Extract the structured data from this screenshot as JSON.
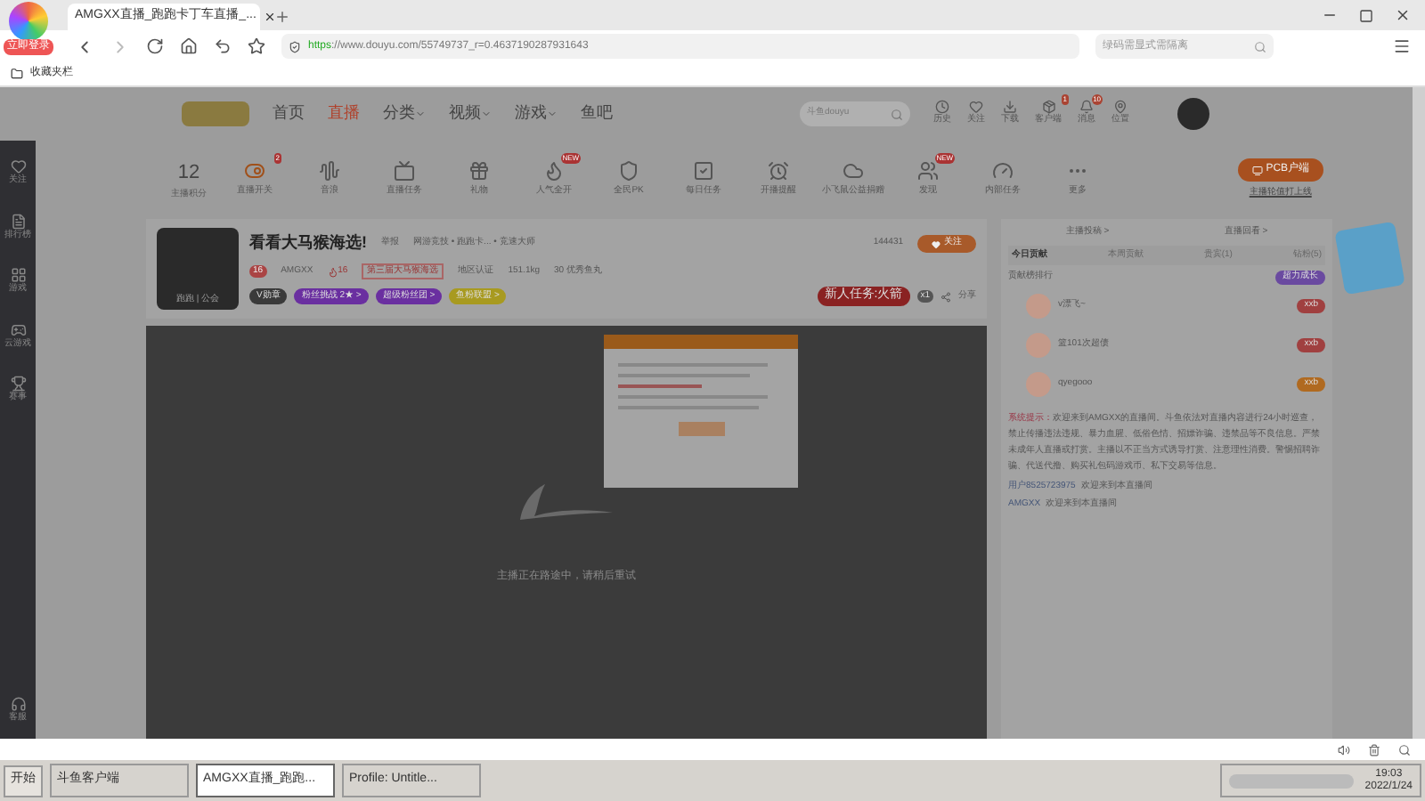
{
  "browser": {
    "tab_title": "AMGXX直播_跑跑卡丁车直播_...",
    "login_badge": "立即登录",
    "url_scheme": "https",
    "url_rest": "://www.douyu.com/55749737_r=0.4637190287931643",
    "search_placeholder": "绿码需显式需隔离",
    "bookmark": "收藏夹栏"
  },
  "sidebar": [
    {
      "label": "关注"
    },
    {
      "label": "排行榜"
    },
    {
      "label": "游戏"
    },
    {
      "label": "云游戏"
    },
    {
      "label": "赛事"
    },
    {
      "label": "客服"
    }
  ],
  "nav": {
    "items": [
      {
        "label": "首页",
        "selected": false,
        "dropdown": false
      },
      {
        "label": "直播",
        "selected": true,
        "dropdown": false
      },
      {
        "label": "分类",
        "selected": false,
        "dropdown": true
      },
      {
        "label": "视频",
        "selected": false,
        "dropdown": true
      },
      {
        "label": "游戏",
        "selected": false,
        "dropdown": true
      },
      {
        "label": "鱼吧",
        "selected": false,
        "dropdown": false
      }
    ],
    "search_placeholder": "斗鱼douyu",
    "user_items": [
      {
        "label": "历史"
      },
      {
        "label": "关注"
      },
      {
        "label": "下载"
      },
      {
        "label": "客户端",
        "badge": "1"
      },
      {
        "label": "消息",
        "badge": "10"
      },
      {
        "label": "位置"
      }
    ]
  },
  "toolbar": {
    "score": "12",
    "score_label": "主播积分",
    "tools": [
      {
        "label": "直播开关",
        "badge": "2"
      },
      {
        "label": "音浪"
      },
      {
        "label": "直播任务"
      },
      {
        "label": "礼物"
      },
      {
        "label": "人气全开",
        "badge": "NEW"
      },
      {
        "label": "全民PK"
      },
      {
        "label": "每日任务"
      },
      {
        "label": "开播提醒"
      },
      {
        "label": "小飞鼠公益捐赠"
      },
      {
        "label": "发现",
        "badge": "NEW"
      },
      {
        "label": "内部任务"
      },
      {
        "label": "更多"
      }
    ],
    "pcb_button": "PCB户端",
    "pcb_link": "主播轮值打上线"
  },
  "streamer": {
    "title": "看看大马猴海选!",
    "report": "举报",
    "category": "网游竞技 • 跑跑卡... • 竞速大师",
    "level": "16",
    "name": "AMGXX",
    "hot": "16",
    "rank": "第三届大马猴海选",
    "location": "地区认证",
    "weight": "151.1kg",
    "count": "30 优秀鱼丸",
    "avatar_text": "跑跑 | 公会",
    "tags": [
      {
        "label": "V勋章",
        "color": "#3a3a3a"
      },
      {
        "label": "粉丝挑战 2★ >",
        "color": "#6a2fa0"
      },
      {
        "label": "超级粉丝团 >",
        "color": "#6a2fa0"
      },
      {
        "label": "鱼粉联盟 >",
        "color": "#a89a20"
      }
    ],
    "follow_count": "144431",
    "follow": "关注",
    "mission": "新人任务:火箭",
    "mission_count": "x1",
    "share": "分享"
  },
  "video": {
    "message": "主播正在路途中，请稍后重试"
  },
  "chat": {
    "links": [
      "主播投稿 >",
      "直播回看 >"
    ],
    "tabs": [
      {
        "label": "今日贡献",
        "selected": true
      },
      {
        "label": "本周贡献",
        "selected": false
      },
      {
        "label": "贵宾(1)",
        "selected": false
      },
      {
        "label": "钻粉(5)",
        "selected": false
      }
    ],
    "rank_title": "贡献榜排行",
    "grow_button": "超力成长",
    "ranks": [
      {
        "name": "v漂飞~",
        "badge": "xxb",
        "color": "#a04040"
      },
      {
        "name": "篮101次超债",
        "badge": "xxb",
        "color": "#a04040"
      },
      {
        "name": "qyegooo",
        "badge": "xxb",
        "color": "#b06a20"
      }
    ],
    "notice_label": "系统提示：",
    "notice": "欢迎来到AMGXX的直播间。斗鱼依法对直播内容进行24小时巡查，禁止传播违法违规、暴力血腥、低俗色情、招嫖诈骗、违禁品等不良信息。严禁未成年人直播或打赏。主播以不正当方式诱导打赏、注意理性消费。警惕招聘诈骗、代送代撸、购买礼包码游戏币、私下交易等信息。",
    "messages": [
      {
        "user": "用户8525723975",
        "text": "欢迎来到本直播间"
      },
      {
        "user": "AMGXX",
        "text": "欢迎来到本直播间"
      }
    ]
  },
  "taskbar": {
    "start": "开始",
    "apps": [
      {
        "label": "斗鱼客户端",
        "selected": false
      },
      {
        "label": "AMGXX直播_跑跑...",
        "selected": true
      },
      {
        "label": "Profile: Untitle...",
        "selected": false
      }
    ],
    "time": "19:03",
    "date": "2022/1/24"
  }
}
